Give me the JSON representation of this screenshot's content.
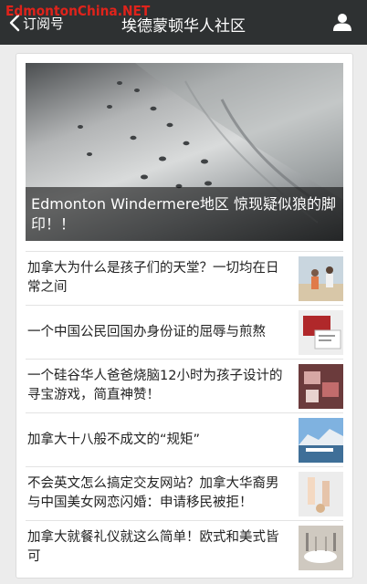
{
  "header": {
    "watermark": "EdmontonChina.NET",
    "back_label": "订阅号",
    "title": "埃德蒙顿华人社区"
  },
  "feed": {
    "hero_title": "Edmonton Windermere地区 惊现疑似狼的脚印！！",
    "articles": [
      {
        "title": "加拿大为什么是孩子们的天堂？一切均在日常之间"
      },
      {
        "title": "一个中国公民回国办身份证的屈辱与煎熬"
      },
      {
        "title": "一个硅谷华人爸爸烧脑12小时为孩子设计的寻宝游戏，简直神赞！"
      },
      {
        "title": "加拿大十八般不成文的“规矩”"
      },
      {
        "title": "不会英文怎么搞定交友网站？加拿大华裔男与中国美女网恋闪婚：申请移民被拒！"
      },
      {
        "title": "加拿大就餐礼仪就这么简单！欧式和美式皆可"
      }
    ]
  }
}
